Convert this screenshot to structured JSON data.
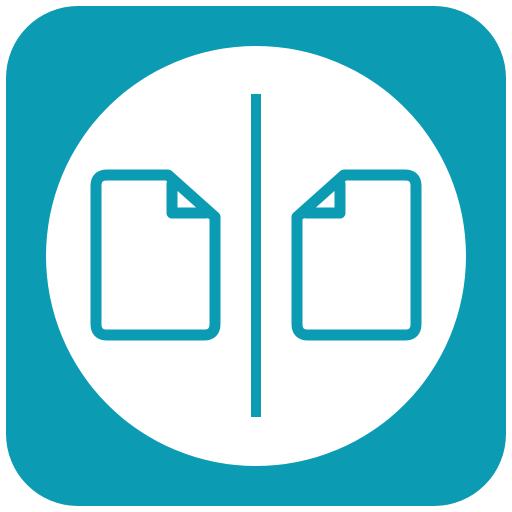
{
  "icon": {
    "semantic": "compare-documents-app-icon",
    "background_color": "#0b9bb2",
    "circle_color": "#ffffff",
    "stroke_color": "#0b9bb2",
    "left_document_icon": "file-icon",
    "right_document_icon": "file-icon-mirrored",
    "divider": "vertical-divider-line"
  }
}
